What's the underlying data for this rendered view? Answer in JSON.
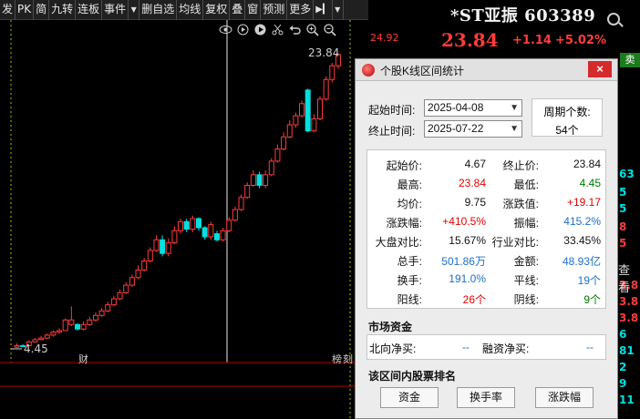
{
  "toolbar": {
    "items": [
      "发",
      "PK",
      "简",
      "九转",
      "连板",
      "事件",
      "▼",
      "删自选",
      "均线",
      "复权",
      "叠",
      "窗",
      "预测",
      "更多",
      "▶▎",
      "▼"
    ]
  },
  "chart": {
    "high_label": "23.84",
    "low_label": "4.45",
    "bottom_label_1": "财",
    "bottom_label_2": "榜",
    "bottom_label_3": "刻",
    "icons": [
      "eye-icon",
      "replay-icon",
      "play-icon",
      "scissors-icon",
      "undo-icon",
      "zoom-in-icon",
      "zoom-out-icon"
    ],
    "up_color": "#ff3c3c",
    "down_color": "#00e0e0",
    "candles": [
      {
        "o": 4.5,
        "c": 4.6,
        "h": 4.75,
        "l": 4.45,
        "u": true
      },
      {
        "o": 4.6,
        "c": 4.55,
        "h": 4.7,
        "l": 4.5,
        "u": false
      },
      {
        "o": 4.6,
        "c": 4.85,
        "h": 4.95,
        "l": 4.55,
        "u": true
      },
      {
        "o": 4.85,
        "c": 5.0,
        "h": 5.1,
        "l": 4.8,
        "u": true
      },
      {
        "o": 5.0,
        "c": 5.1,
        "h": 5.25,
        "l": 4.95,
        "u": true
      },
      {
        "o": 5.1,
        "c": 5.3,
        "h": 5.4,
        "l": 5.05,
        "u": true
      },
      {
        "o": 5.3,
        "c": 5.5,
        "h": 5.6,
        "l": 5.2,
        "u": true
      },
      {
        "o": 5.5,
        "c": 5.6,
        "h": 5.75,
        "l": 5.4,
        "u": true
      },
      {
        "o": 5.6,
        "c": 6.3,
        "h": 6.4,
        "l": 5.6,
        "u": true
      },
      {
        "o": 6.3,
        "c": 6.0,
        "h": 7.2,
        "l": 5.9,
        "u": true
      },
      {
        "o": 6.0,
        "c": 5.7,
        "h": 6.1,
        "l": 5.6,
        "u": false
      },
      {
        "o": 5.7,
        "c": 6.0,
        "h": 6.2,
        "l": 5.6,
        "u": true
      },
      {
        "o": 6.0,
        "c": 6.3,
        "h": 6.5,
        "l": 5.9,
        "u": true
      },
      {
        "o": 6.3,
        "c": 6.6,
        "h": 6.8,
        "l": 6.2,
        "u": true
      },
      {
        "o": 6.6,
        "c": 6.9,
        "h": 7.1,
        "l": 6.5,
        "u": true
      },
      {
        "o": 6.9,
        "c": 7.3,
        "h": 7.5,
        "l": 6.8,
        "u": true
      },
      {
        "o": 7.3,
        "c": 7.7,
        "h": 7.9,
        "l": 7.2,
        "u": true
      },
      {
        "o": 7.7,
        "c": 8.1,
        "h": 8.3,
        "l": 7.6,
        "u": true
      },
      {
        "o": 8.1,
        "c": 8.6,
        "h": 8.8,
        "l": 8.0,
        "u": true
      },
      {
        "o": 8.6,
        "c": 9.1,
        "h": 9.3,
        "l": 8.5,
        "u": true
      },
      {
        "o": 9.1,
        "c": 9.6,
        "h": 9.9,
        "l": 9.0,
        "u": true
      },
      {
        "o": 9.6,
        "c": 10.2,
        "h": 10.4,
        "l": 9.5,
        "u": true
      },
      {
        "o": 10.2,
        "c": 10.9,
        "h": 11.1,
        "l": 10.1,
        "u": true
      },
      {
        "o": 10.9,
        "c": 11.6,
        "h": 11.9,
        "l": 10.8,
        "u": true
      },
      {
        "o": 11.6,
        "c": 10.7,
        "h": 11.9,
        "l": 10.5,
        "u": false
      },
      {
        "o": 10.7,
        "c": 11.4,
        "h": 11.7,
        "l": 10.5,
        "u": true
      },
      {
        "o": 11.4,
        "c": 12.2,
        "h": 12.5,
        "l": 11.3,
        "u": true
      },
      {
        "o": 12.2,
        "c": 12.8,
        "h": 13.0,
        "l": 12.0,
        "u": true
      },
      {
        "o": 12.8,
        "c": 12.3,
        "h": 13.0,
        "l": 12.1,
        "u": false
      },
      {
        "o": 12.3,
        "c": 13.0,
        "h": 13.2,
        "l": 12.1,
        "u": true
      },
      {
        "o": 13.0,
        "c": 12.4,
        "h": 13.1,
        "l": 12.2,
        "u": false
      },
      {
        "o": 12.4,
        "c": 11.8,
        "h": 12.5,
        "l": 11.6,
        "u": false
      },
      {
        "o": 11.8,
        "c": 12.6,
        "h": 12.8,
        "l": 11.6,
        "u": true
      },
      {
        "o": 12.0,
        "c": 11.6,
        "h": 12.2,
        "l": 11.5,
        "u": false
      },
      {
        "o": 11.6,
        "c": 12.2,
        "h": 12.4,
        "l": 11.5,
        "u": true
      },
      {
        "o": 12.2,
        "c": 12.9,
        "h": 13.1,
        "l": 12.1,
        "u": true
      },
      {
        "o": 12.9,
        "c": 13.6,
        "h": 13.8,
        "l": 12.8,
        "u": true
      },
      {
        "o": 13.6,
        "c": 14.4,
        "h": 14.6,
        "l": 13.5,
        "u": true
      },
      {
        "o": 14.4,
        "c": 15.2,
        "h": 15.4,
        "l": 14.3,
        "u": true
      },
      {
        "o": 15.2,
        "c": 15.9,
        "h": 16.2,
        "l": 15.1,
        "u": true
      },
      {
        "o": 15.9,
        "c": 15.2,
        "h": 16.1,
        "l": 15.0,
        "u": false
      },
      {
        "o": 15.2,
        "c": 15.9,
        "h": 16.2,
        "l": 15.0,
        "u": true
      },
      {
        "o": 15.9,
        "c": 16.8,
        "h": 17.0,
        "l": 15.8,
        "u": true
      },
      {
        "o": 16.8,
        "c": 17.6,
        "h": 17.9,
        "l": 16.7,
        "u": true
      },
      {
        "o": 17.6,
        "c": 18.4,
        "h": 18.7,
        "l": 17.5,
        "u": true
      },
      {
        "o": 18.4,
        "c": 19.2,
        "h": 19.5,
        "l": 18.3,
        "u": true
      },
      {
        "o": 19.2,
        "c": 19.8,
        "h": 20.0,
        "l": 19.0,
        "u": true
      },
      {
        "o": 19.8,
        "c": 20.6,
        "h": 20.8,
        "l": 19.7,
        "u": true
      },
      {
        "o": 21.5,
        "c": 18.8,
        "h": 21.6,
        "l": 18.7,
        "u": false
      },
      {
        "o": 18.8,
        "c": 19.6,
        "h": 19.9,
        "l": 18.7,
        "u": true
      },
      {
        "o": 19.6,
        "c": 20.9,
        "h": 21.1,
        "l": 19.5,
        "u": true
      },
      {
        "o": 20.9,
        "c": 22.2,
        "h": 22.4,
        "l": 20.8,
        "u": true
      },
      {
        "o": 22.2,
        "c": 23.1,
        "h": 23.3,
        "l": 22.0,
        "u": true
      },
      {
        "o": 23.1,
        "c": 23.84,
        "h": 23.84,
        "l": 22.9,
        "u": true
      }
    ]
  },
  "quote": {
    "name_code": "*ST亚振 603389",
    "price": "23.84",
    "change": "+1.14",
    "pct": "+5.02%",
    "side_value": "24.92",
    "sell_tag": "卖",
    "side_text": "查看"
  },
  "dialog": {
    "title": "个股K线区间统计",
    "close": "×",
    "start_label": "起始时间:",
    "start_date": "2025-04-08",
    "end_label": "终止时间:",
    "end_date": "2025-07-22",
    "period_label": "周期个数:",
    "period_value": "54个",
    "stats": [
      {
        "l1": "起始价:",
        "v1": "4.67",
        "c1": "black",
        "l2": "终止价:",
        "v2": "23.84",
        "c2": "black"
      },
      {
        "l1": "最高:",
        "v1": "23.84",
        "c1": "red",
        "l2": "最低:",
        "v2": "4.45",
        "c2": "green"
      },
      {
        "l1": "均价:",
        "v1": "9.75",
        "c1": "black",
        "l2": "涨跌值:",
        "v2": "+19.17",
        "c2": "red"
      },
      {
        "l1": "涨跌幅:",
        "v1": "+410.5%",
        "c1": "red",
        "l2": "振幅:",
        "v2": "415.2%",
        "c2": "blue"
      },
      {
        "l1": "大盘对比:",
        "v1": "15.67%",
        "c1": "black",
        "l2": "行业对比:",
        "v2": "33.45%",
        "c2": "black"
      },
      {
        "l1": "总手:",
        "v1": "501.86万",
        "c1": "blue",
        "l2": "金额:",
        "v2": "48.93亿",
        "c2": "blue"
      },
      {
        "l1": "换手:",
        "v1": "191.0%",
        "c1": "blue",
        "l2": "平线:",
        "v2": "19个",
        "c2": "blue"
      },
      {
        "l1": "阳线:",
        "v1": "26个",
        "c1": "red",
        "l2": "阴线:",
        "v2": "9个",
        "c2": "green"
      }
    ],
    "fund_title": "市场资金",
    "north_label": "北向净买:",
    "north_value": "--",
    "margin_label": "融资净买:",
    "margin_value": "--",
    "rank_title": "该区间内股票排名",
    "rank_buttons": [
      "资金",
      "换手率",
      "涨跌幅"
    ]
  }
}
